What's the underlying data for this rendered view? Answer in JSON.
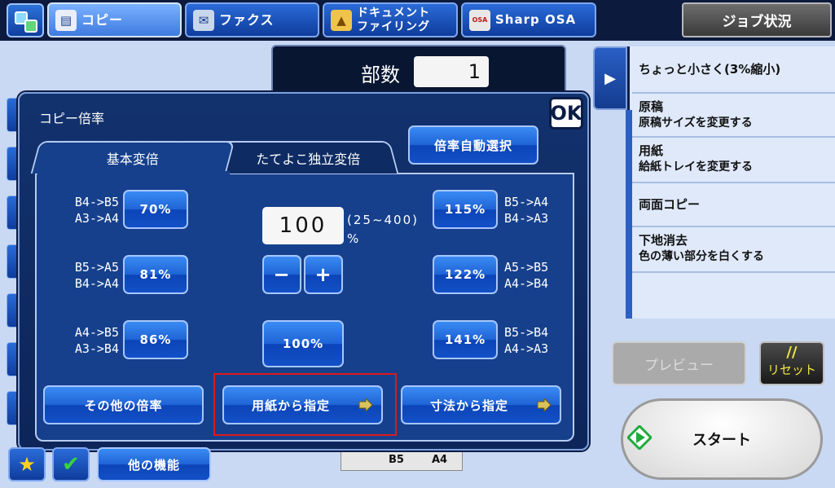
{
  "top_tabs": {
    "copy": "コピー",
    "fax": "ファクス",
    "doc_filing_line1": "ドキュメント",
    "doc_filing_line2": "ファイリング",
    "sharp_osa": "Sharp OSA",
    "osa_badge": "OSA",
    "job_status": "ジョブ状況"
  },
  "copies": {
    "label": "部数",
    "value": "1"
  },
  "dialog": {
    "title": "コピー倍率",
    "ok": "OK",
    "auto_select": "倍率自動選択",
    "tabs": [
      "基本変倍",
      "たてよこ独立変倍"
    ],
    "left_ratios": [
      {
        "line1": "B4->B5",
        "line2": "A3->A4",
        "button": "70%"
      },
      {
        "line1": "B5->A5",
        "line2": "B4->A4",
        "button": "81%"
      },
      {
        "line1": "A4->B5",
        "line2": "A3->B4",
        "button": "86%"
      }
    ],
    "right_ratios": [
      {
        "line1": "B5->A4",
        "line2": "B4->A3",
        "button": "115%"
      },
      {
        "line1": "A5->B5",
        "line2": "A4->B4",
        "button": "122%"
      },
      {
        "line1": "B5->B4",
        "line2": "A4->A3",
        "button": "141%"
      }
    ],
    "zoom_value": "100",
    "range": "(25~400)",
    "unit": "%",
    "minus": "−",
    "plus": "+",
    "reset_100": "100%",
    "other_ratio": "その他の倍率",
    "from_paper": "用紙から指定",
    "from_size": "寸法から指定"
  },
  "right_panel": {
    "items": [
      {
        "title": "ちょっと小さく(3%縮小)",
        "sub": ""
      },
      {
        "title": "原稿",
        "sub": "原稿サイズを変更する"
      },
      {
        "title": "用紙",
        "sub": "給紙トレイを変更する"
      },
      {
        "title": "両面コピー",
        "sub": ""
      },
      {
        "title": "下地消去",
        "sub": "色の薄い部分を白くする"
      }
    ]
  },
  "preview": "プレビュー",
  "reset_mark": "//",
  "reset": "リセット",
  "start": "スタート",
  "other_functions": "他の機能",
  "trays": [
    "B5",
    "A4"
  ],
  "colors": {
    "accent": "#1f63d6",
    "highlight": "#e01919",
    "reset_text": "#f3e844"
  }
}
